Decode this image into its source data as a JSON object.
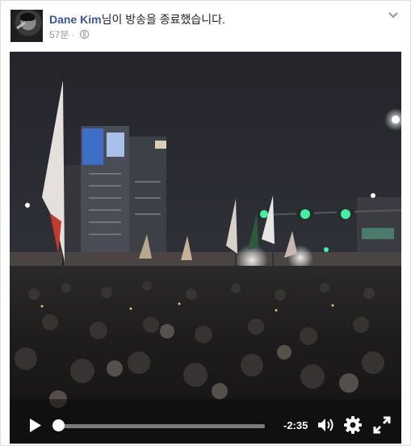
{
  "post": {
    "author": "Dane Kim",
    "action_text": "님이 방송을 종료했습니다.",
    "timestamp": "57분",
    "separator": "·",
    "privacy_icon": "globe-icon",
    "menu_icon": "chevron-down-icon"
  },
  "video": {
    "remaining_time": "-2:35",
    "progress_fraction": 0.0,
    "icons": [
      "play-icon",
      "volume-icon",
      "gear-icon",
      "fullscreen-icon"
    ]
  },
  "colors": {
    "author_link": "#365899",
    "meta_text": "#90949c",
    "body_text": "#1d2129"
  }
}
